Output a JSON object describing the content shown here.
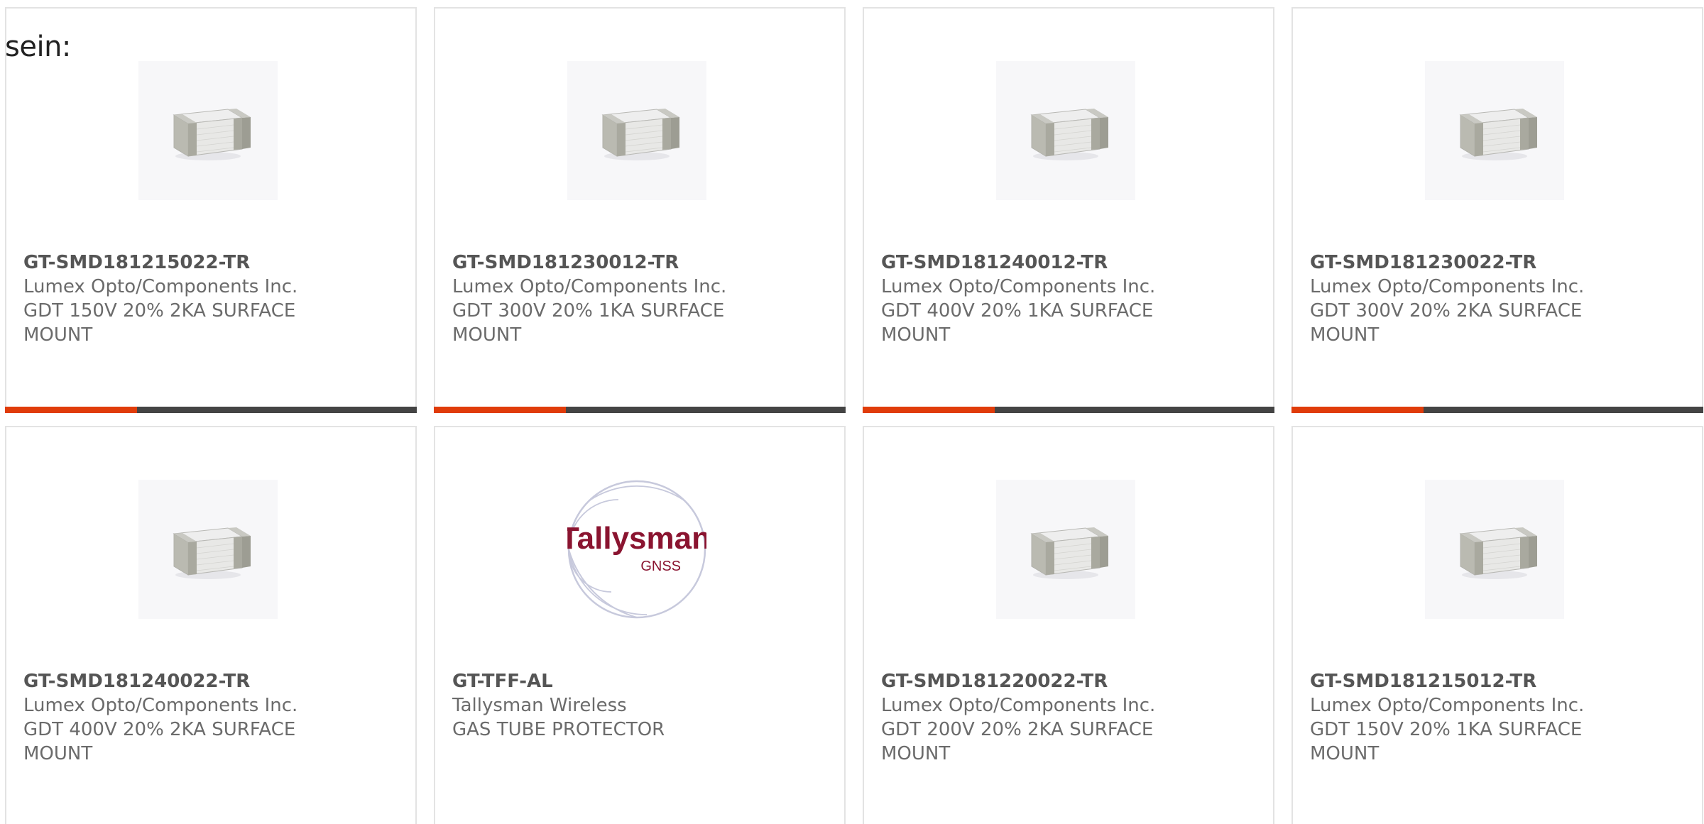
{
  "heading": "sein:",
  "colors": {
    "accent": "#e03c0a",
    "bar": "#444444",
    "card_border": "#e3e3e3",
    "part_number": "#555555",
    "text": "#6b6b6b"
  },
  "products": [
    {
      "part_number": "GT-SMD181215022-TR",
      "manufacturer": "Lumex Opto/Components Inc.",
      "description": "GDT 150V 20% 2KA SURFACE MOUNT",
      "image": "smd-component-icon",
      "progress": 0.32
    },
    {
      "part_number": "GT-SMD181230012-TR",
      "manufacturer": "Lumex Opto/Components Inc.",
      "description": "GDT 300V 20% 1KA SURFACE MOUNT",
      "image": "smd-component-icon",
      "progress": 0.32
    },
    {
      "part_number": "GT-SMD181240012-TR",
      "manufacturer": "Lumex Opto/Components Inc.",
      "description": "GDT 400V 20% 1KA SURFACE MOUNT",
      "image": "smd-component-icon",
      "progress": 0.32
    },
    {
      "part_number": "GT-SMD181230022-TR",
      "manufacturer": "Lumex Opto/Components Inc.",
      "description": "GDT 300V 20% 2KA SURFACE MOUNT",
      "image": "smd-component-icon",
      "progress": 0.32
    },
    {
      "part_number": "GT-SMD181240022-TR",
      "manufacturer": "Lumex Opto/Components Inc.",
      "description": "GDT 400V 20% 2KA SURFACE MOUNT",
      "image": "smd-component-icon"
    },
    {
      "part_number": "GT-TFF-AL",
      "manufacturer": "Tallysman Wireless",
      "description": "GAS TUBE PROTECTOR",
      "image": "tallysman-logo",
      "logo_text": "Tallysman",
      "logo_sub": "GNSS"
    },
    {
      "part_number": "GT-SMD181220022-TR",
      "manufacturer": "Lumex Opto/Components Inc.",
      "description": "GDT 200V 20% 2KA SURFACE MOUNT",
      "image": "smd-component-icon"
    },
    {
      "part_number": "GT-SMD181215012-TR",
      "manufacturer": "Lumex Opto/Components Inc.",
      "description": "GDT 150V 20% 1KA SURFACE MOUNT",
      "image": "smd-component-icon"
    }
  ]
}
